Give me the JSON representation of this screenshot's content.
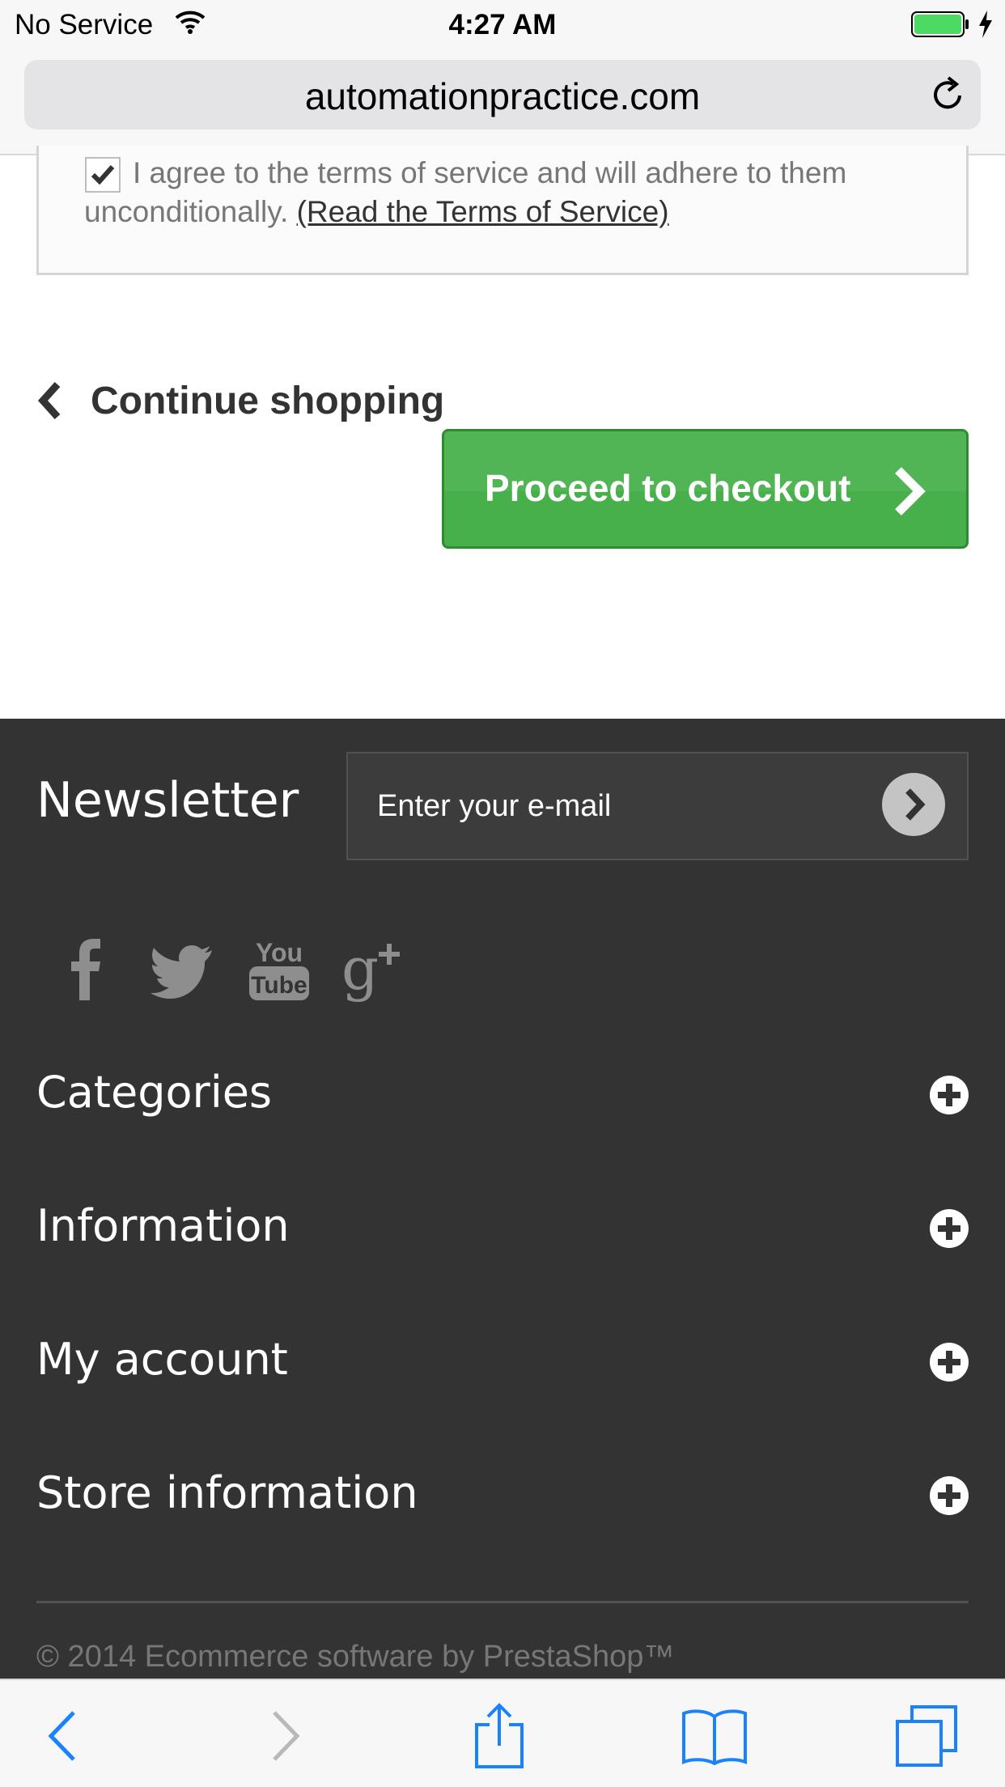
{
  "status_bar": {
    "carrier": "No Service",
    "time": "4:27 AM"
  },
  "browser": {
    "url": "automationpractice.com"
  },
  "terms": {
    "checked": true,
    "text": "I agree to the terms of service and will adhere to them unconditionally.",
    "link": "(Read the Terms of Service)"
  },
  "cart_nav": {
    "continue_label": "Continue shopping",
    "checkout_label": "Proceed to checkout"
  },
  "footer": {
    "newsletter": {
      "title": "Newsletter",
      "placeholder": "Enter your e-mail"
    },
    "social": [
      "facebook-icon",
      "twitter-icon",
      "youtube-icon",
      "google-plus-icon"
    ],
    "sections": [
      {
        "label": "Categories"
      },
      {
        "label": "Information"
      },
      {
        "label": "My account"
      },
      {
        "label": "Store information"
      }
    ],
    "copyright": "© 2014 Ecommerce software by PrestaShop™"
  },
  "colors": {
    "checkout_green": "#47b04b",
    "footer_bg": "#333333",
    "ios_blue": "#1a82fb"
  }
}
